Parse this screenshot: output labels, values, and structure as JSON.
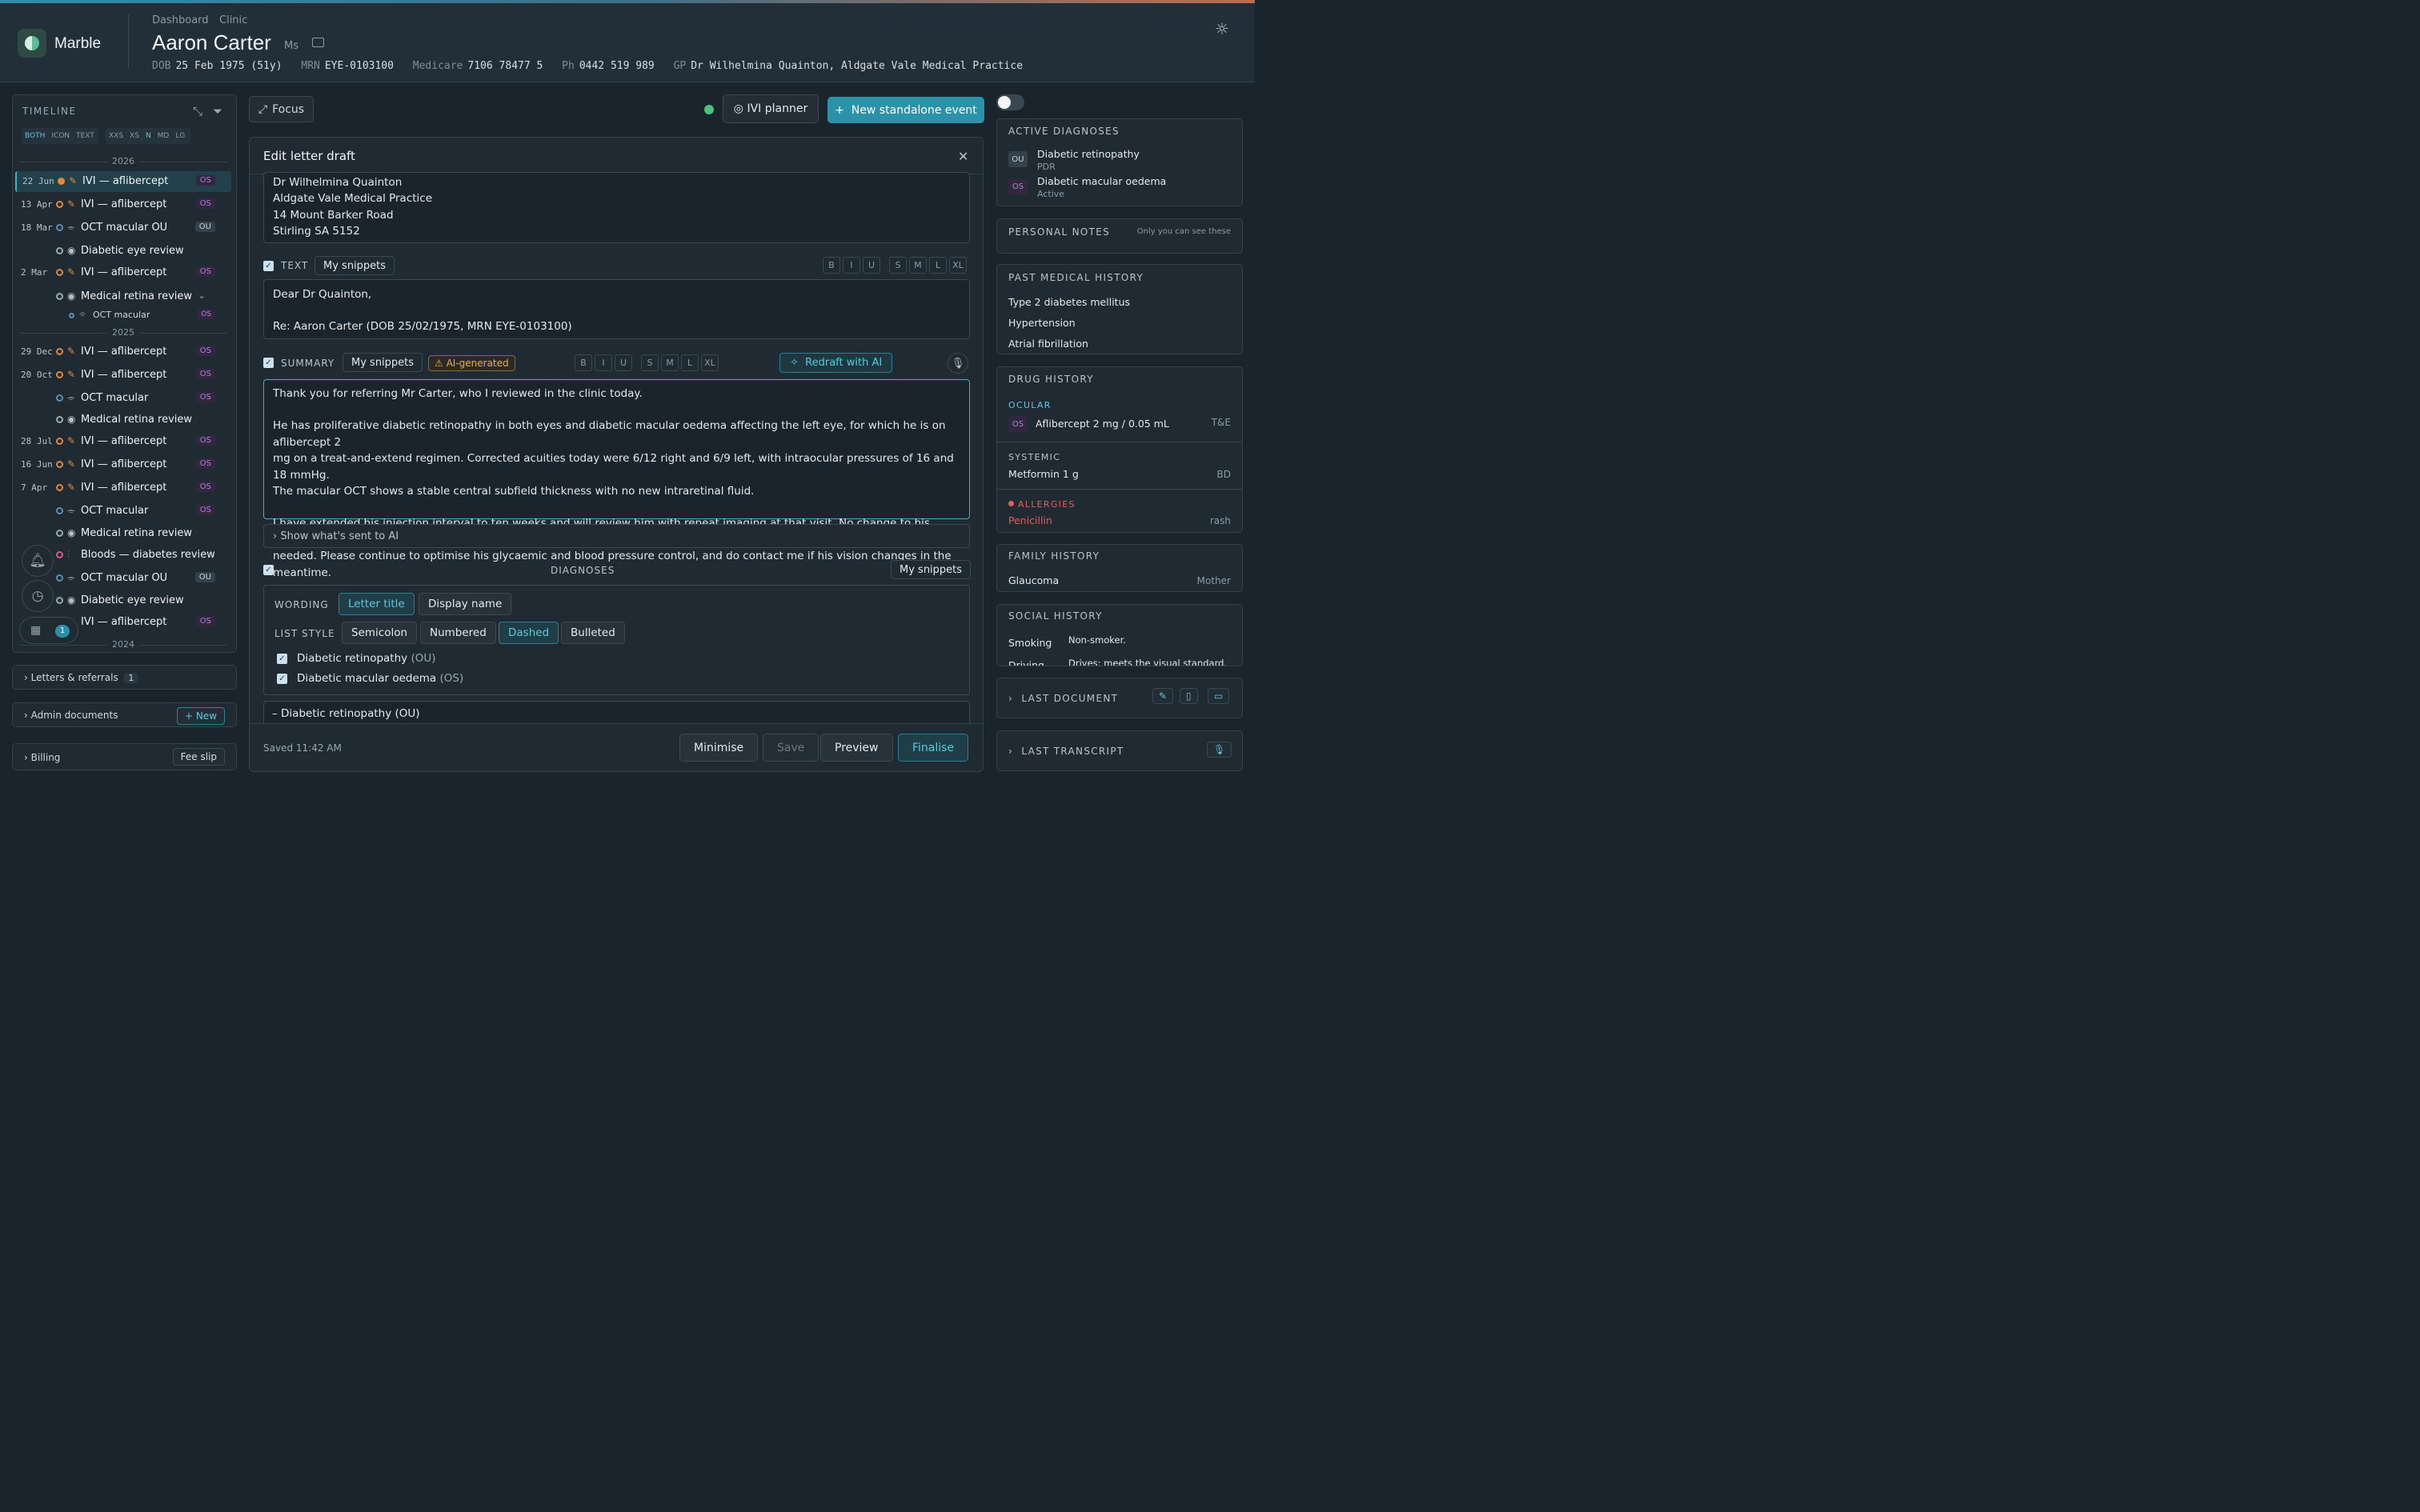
{
  "app": {
    "brand": "Marble"
  },
  "breadcrumbs": [
    "Dashboard",
    "Clinic"
  ],
  "patient": {
    "name": "Aaron Carter",
    "title": "Ms",
    "dob_label": "DOB",
    "dob": "25 Feb 1975 (51y)",
    "mrn_label": "MRN",
    "mrn": "EYE-0103100",
    "medicare_label": "Medicare",
    "medicare": "7106 78477 5",
    "ph_label": "Ph",
    "ph": "0442 519 989",
    "gp_label": "GP",
    "gp": "Dr Wilhelmina Quainton, Aldgate Vale Medical Practice"
  },
  "timeline": {
    "title": "TIMELINE",
    "modes": [
      "BOTH",
      "ICON",
      "TEXT"
    ],
    "sizes": [
      "XXS",
      "XS",
      "N",
      "MD",
      "LG"
    ],
    "years": [
      "2026",
      "2025",
      "2024"
    ],
    "rows": [
      {
        "date": "22 Jun",
        "icon": "✎",
        "label": "IVI — aflibercept",
        "tag": "OS"
      },
      {
        "date": "13 Apr",
        "icon": "✎",
        "label": "IVI — aflibercept",
        "tag": "OS"
      },
      {
        "date": "18 Mar",
        "icon": "⌯",
        "label": "OCT macular OU",
        "tag": "OU"
      },
      {
        "date": "",
        "icon": "◉",
        "label": "Diabetic eye review",
        "tag": ""
      },
      {
        "date": "2 Mar",
        "icon": "✎",
        "label": "IVI — aflibercept",
        "tag": "OS"
      },
      {
        "date": "",
        "icon": "◉",
        "label": "Medical retina review",
        "tag": "",
        "chev": "⌄"
      },
      {
        "date": "",
        "icon": "⌯",
        "label": "OCT macular",
        "tag": "OS"
      },
      {
        "date": "29 Dec",
        "icon": "✎",
        "label": "IVI — aflibercept",
        "tag": "OS"
      },
      {
        "date": "20 Oct",
        "icon": "✎",
        "label": "IVI — aflibercept",
        "tag": "OS"
      },
      {
        "date": "",
        "icon": "⌯",
        "label": "OCT macular",
        "tag": "OS"
      },
      {
        "date": "",
        "icon": "◉",
        "label": "Medical retina review",
        "tag": ""
      },
      {
        "date": "28 Jul",
        "icon": "✎",
        "label": "IVI — aflibercept",
        "tag": "OS"
      },
      {
        "date": "16 Jun",
        "icon": "✎",
        "label": "IVI — aflibercept",
        "tag": "OS"
      },
      {
        "date": "7 Apr",
        "icon": "✎",
        "label": "IVI — aflibercept",
        "tag": "OS"
      },
      {
        "date": "",
        "icon": "⌯",
        "label": "OCT macular",
        "tag": "OS"
      },
      {
        "date": "",
        "icon": "◉",
        "label": "Medical retina review",
        "tag": ""
      },
      {
        "date": "",
        "icon": "⫶",
        "label": "Bloods — diabetes review",
        "tag": ""
      },
      {
        "date": "",
        "icon": "⌯",
        "label": "OCT macular OU",
        "tag": "OU"
      },
      {
        "date": "",
        "icon": "◉",
        "label": "Diabetic eye review",
        "tag": ""
      },
      {
        "date": "",
        "icon": "✎",
        "label": "IVI — aflibercept",
        "tag": "OS"
      }
    ],
    "calendar_badge": "1"
  },
  "accordions": {
    "letters": "Letters & referrals",
    "letters_count": "1",
    "admin": "Admin documents",
    "admin_new": "+ New",
    "billing": "Billing",
    "billing_btn": "Fee slip"
  },
  "toolbar": {
    "focus": "Focus",
    "ivi_planner": "IVI planner",
    "new_event": "New standalone event"
  },
  "letter": {
    "title": "Edit letter draft",
    "address": [
      "Dr Wilhelmina Quainton",
      "Aldgate Vale Medical Practice",
      "14 Mount Barker Road",
      "Stirling SA 5152"
    ],
    "text_label": "TEXT",
    "snippets": "My snippets",
    "format": [
      "B",
      "I",
      "U",
      "S",
      "M",
      "L",
      "XL"
    ],
    "text_lines": [
      "Dear Dr Quainton,",
      "",
      "Re: Aaron Carter (DOB 25/02/1975, MRN EYE-0103100)"
    ],
    "summary_label": "SUMMARY",
    "ai_generated": "⚠ AI-generated",
    "redraft": "Redraft with AI",
    "summary_lines": [
      "Thank you for referring Mr Carter, who I reviewed in the clinic today.",
      "",
      "He has proliferative diabetic retinopathy in both eyes and diabetic macular oedema affecting the left eye, for which he is on aflibercept 2",
      "mg on a treat-and-extend regimen. Corrected acuities today were 6/12 right and 6/9 left, with intraocular pressures of 16 and 18 mmHg.",
      "The macular OCT shows a stable central subfield thickness with no new intraretinal fluid.",
      "",
      "I have extended his injection interval to ten weeks and will review him with repeat imaging at that visit. No change to his current drops is",
      "needed. Please continue to optimise his glycaemic and blood pressure control, and do contact me if his vision changes in the meantime."
    ],
    "show_ai": "Show what's sent to AI",
    "diagnoses_label": "DIAGNOSES",
    "wording_label": "WORDING",
    "wording": [
      "Letter title",
      "Display name"
    ],
    "list_style_label": "LIST STYLE",
    "list_styles": [
      "Semicolon",
      "Numbered",
      "Dashed",
      "Bulleted"
    ],
    "diagnoses": [
      {
        "name": "Diabetic retinopathy",
        "eye": "(OU)"
      },
      {
        "name": "Diabetic macular oedema",
        "eye": "(OS)"
      }
    ],
    "preview_line": "– Diabetic retinopathy (OU)",
    "saved": "Saved 11:42 AM",
    "buttons": {
      "minimise": "Minimise",
      "save": "Save",
      "preview": "Preview",
      "finalise": "Finalise"
    }
  },
  "right": {
    "active_dx": "ACTIVE DIAGNOSES",
    "dx": [
      {
        "eye": "OU",
        "name": "Diabetic retinopathy",
        "sub": "PDR"
      },
      {
        "eye": "OS",
        "name": "Diabetic macular oedema",
        "sub": "Active"
      }
    ],
    "personal_notes": "PERSONAL NOTES",
    "personal_notes_hint": "Only you can see these",
    "pmh": "PAST MEDICAL HISTORY",
    "pmh_items": [
      "Type 2 diabetes mellitus",
      "Hypertension",
      "Atrial fibrillation"
    ],
    "drug_history": "DRUG HISTORY",
    "ocular": "OCULAR",
    "ocular_drug": "Aflibercept 2 mg / 0.05 mL",
    "ocular_eye": "OS",
    "ocular_freq": "T&E",
    "systemic": "SYSTEMIC",
    "systemic_drug": "Metformin 1 g",
    "systemic_freq": "BD",
    "allergies": "ALLERGIES",
    "allergy": "Penicillin",
    "allergy_reaction": "rash",
    "family_history": "FAMILY HISTORY",
    "fh_item": "Glaucoma",
    "fh_rel": "Mother",
    "social_history": "SOCIAL HISTORY",
    "smoking_label": "Smoking",
    "smoking": "Non-smoker.",
    "driving_label": "Driving",
    "driving": "Drives; meets the visual standard.",
    "last_document": "LAST DOCUMENT",
    "last_transcript": "LAST TRANSCRIPT"
  },
  "colors": {
    "accent": "#2b93a9",
    "orange": "#e2873c",
    "purple": "#a884d8",
    "alert": "#e0605a"
  }
}
